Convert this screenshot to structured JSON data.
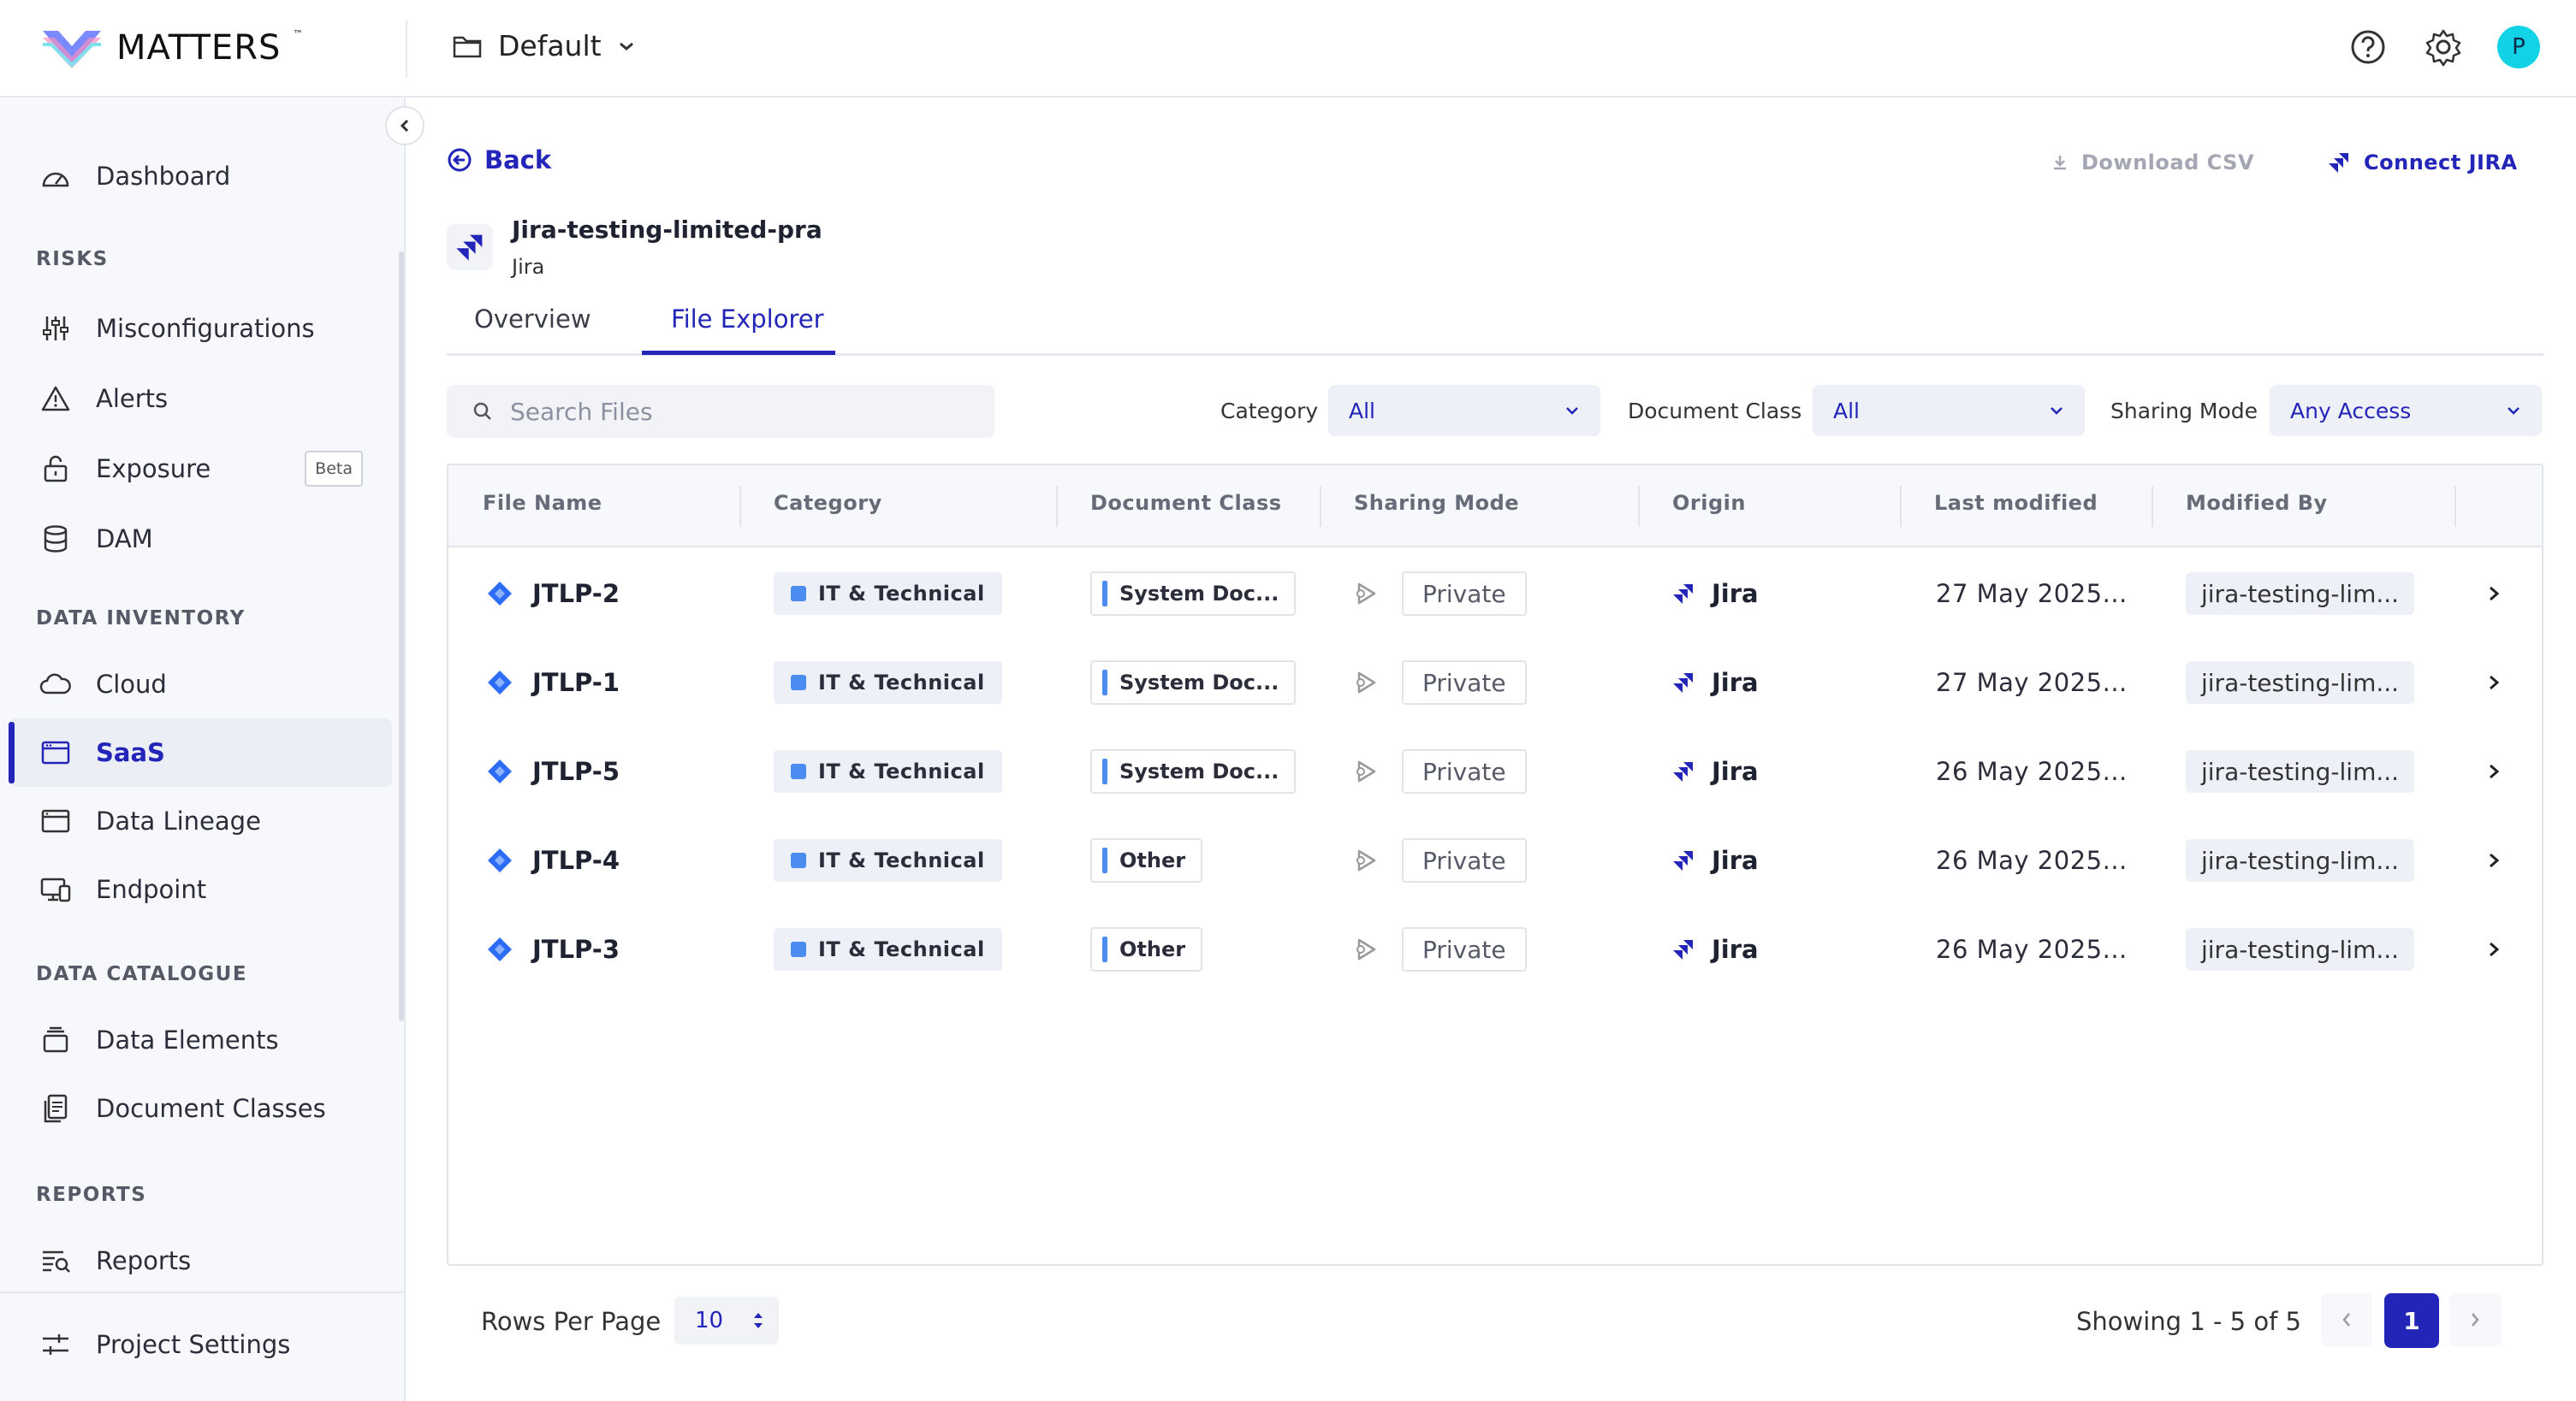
{
  "brand": {
    "name": "MATTERS",
    "tm": "™"
  },
  "workspace": {
    "label": "Default"
  },
  "user": {
    "initial": "P",
    "avatar_color": "#12d3e6"
  },
  "sidebar": {
    "dashboard": "Dashboard",
    "sections": {
      "risks": "RISKS",
      "inventory": "DATA INVENTORY",
      "catalogue": "DATA CATALOGUE",
      "reports": "REPORTS"
    },
    "items": {
      "misconfigurations": "Misconfigurations",
      "alerts": "Alerts",
      "exposure": "Exposure",
      "exposure_badge": "Beta",
      "dam": "DAM",
      "cloud": "Cloud",
      "saas": "SaaS",
      "lineage": "Data Lineage",
      "endpoint": "Endpoint",
      "elements": "Data Elements",
      "doc_classes": "Document Classes",
      "reports": "Reports",
      "project_settings": "Project Settings"
    }
  },
  "header": {
    "back": "Back",
    "download": "Download CSV",
    "connect": "Connect JIRA"
  },
  "app": {
    "name": "Jira-testing-limited-pra",
    "type": "Jira"
  },
  "tabs": [
    "Overview",
    "File Explorer"
  ],
  "search": {
    "placeholder": "Search Files"
  },
  "filters": {
    "category": {
      "label": "Category",
      "value": "All"
    },
    "doc_class": {
      "label": "Document Class",
      "value": "All"
    },
    "sharing": {
      "label": "Sharing Mode",
      "value": "Any Access"
    }
  },
  "table": {
    "columns": [
      "File Name",
      "Category",
      "Document Class",
      "Sharing Mode",
      "Origin",
      "Last modified",
      "Modified By"
    ],
    "rows": [
      {
        "name": "JTLP-2",
        "category": "IT & Technical",
        "doc_class": "System Doc...",
        "sharing": "Private",
        "origin": "Jira",
        "modified": "27 May 2025...",
        "by": "jira-testing-lim..."
      },
      {
        "name": "JTLP-1",
        "category": "IT & Technical",
        "doc_class": "System Doc...",
        "sharing": "Private",
        "origin": "Jira",
        "modified": "27 May 2025...",
        "by": "jira-testing-lim..."
      },
      {
        "name": "JTLP-5",
        "category": "IT & Technical",
        "doc_class": "System Doc...",
        "sharing": "Private",
        "origin": "Jira",
        "modified": "26 May 2025...",
        "by": "jira-testing-lim..."
      },
      {
        "name": "JTLP-4",
        "category": "IT & Technical",
        "doc_class": "Other",
        "sharing": "Private",
        "origin": "Jira",
        "modified": "26 May 2025...",
        "by": "jira-testing-lim..."
      },
      {
        "name": "JTLP-3",
        "category": "IT & Technical",
        "doc_class": "Other",
        "sharing": "Private",
        "origin": "Jira",
        "modified": "26 May 2025...",
        "by": "jira-testing-lim..."
      }
    ]
  },
  "pagination": {
    "rows_label": "Rows Per Page",
    "rows_value": "10",
    "showing": "Showing 1 - 5 of 5",
    "current_page": "1"
  },
  "colors": {
    "accent": "#2324b8",
    "category_dot": "#4a8cf0"
  }
}
